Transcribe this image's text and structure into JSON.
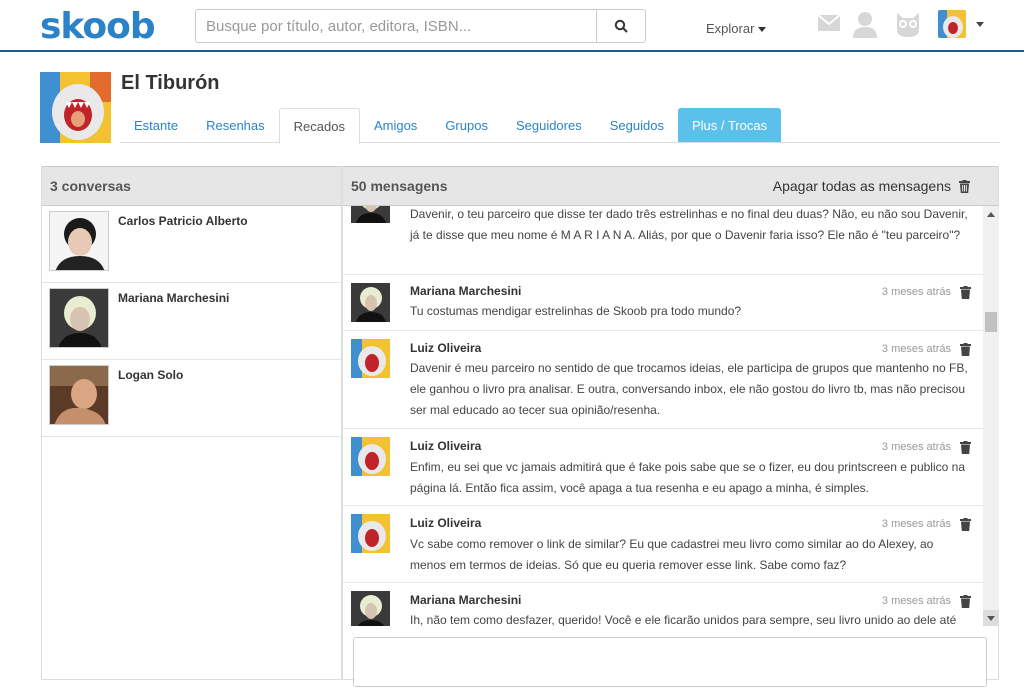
{
  "header": {
    "logo": "skoob",
    "search_placeholder": "Busque por título, autor, editora, ISBN...",
    "explore_label": "Explorar"
  },
  "profile": {
    "name": "El Tiburón"
  },
  "tabs": [
    {
      "label": "Estante"
    },
    {
      "label": "Resenhas"
    },
    {
      "label": "Recados"
    },
    {
      "label": "Amigos"
    },
    {
      "label": "Grupos"
    },
    {
      "label": "Seguidores"
    },
    {
      "label": "Seguidos"
    },
    {
      "label": "Plus / Trocas"
    }
  ],
  "conversations": {
    "header": "3 conversas",
    "items": [
      {
        "name": "Carlos Patricio Alberto"
      },
      {
        "name": "Mariana Marchesini"
      },
      {
        "name": "Logan Solo"
      }
    ]
  },
  "messages": {
    "header": "50 mensagens",
    "delete_all_label": "Apagar todas as mensagens",
    "items": [
      {
        "author": "",
        "time": "",
        "text": "Davenir, o teu parceiro que disse ter dado três estrelinhas e no final deu duas? Não, eu não sou Davenir, já te disse que meu nome é M A R I A N A. Aliás, por que o Davenir faria isso? Ele não é \"teu parceiro\"?"
      },
      {
        "author": "Mariana Marchesini",
        "time": "3 meses atrás",
        "text": "Tu costumas mendigar estrelinhas de Skoob pra todo mundo?"
      },
      {
        "author": "Luiz Oliveira",
        "time": "3 meses atrás",
        "text": "Davenir é meu parceiro no sentido de que trocamos ideias, ele participa de grupos que mantenho no FB, ele ganhou o livro pra analisar. E outra, conversando inbox, ele não gostou do livro tb, mas não precisou ser mal educado ao tecer sua opinião/resenha."
      },
      {
        "author": "Luiz Oliveira",
        "time": "3 meses atrás",
        "text": "Enfim, eu sei que vc jamais admitirá que é fake pois sabe que se o fizer, eu dou printscreen e publico na página lá. Então fica assim, você apaga a tua resenha e eu apago a minha, é simples."
      },
      {
        "author": "Luiz Oliveira",
        "time": "3 meses atrás",
        "text": "Vc sabe como remover o link de similar? Eu que cadastrei meu livro como similar ao do Alexey, ao menos em termos de ideias. Só que eu queria remover esse link. Sabe como faz?"
      },
      {
        "author": "Mariana Marchesini",
        "time": "3 meses atrás",
        "text": "Ih, não tem como desfazer, querido! Você e ele ficarão unidos para sempre, seu livro unido ao dele até"
      }
    ]
  },
  "colors": {
    "brand": "#2b82c9",
    "plus_tab": "#5bc0ea",
    "panel_header": "#e6e6e6"
  }
}
